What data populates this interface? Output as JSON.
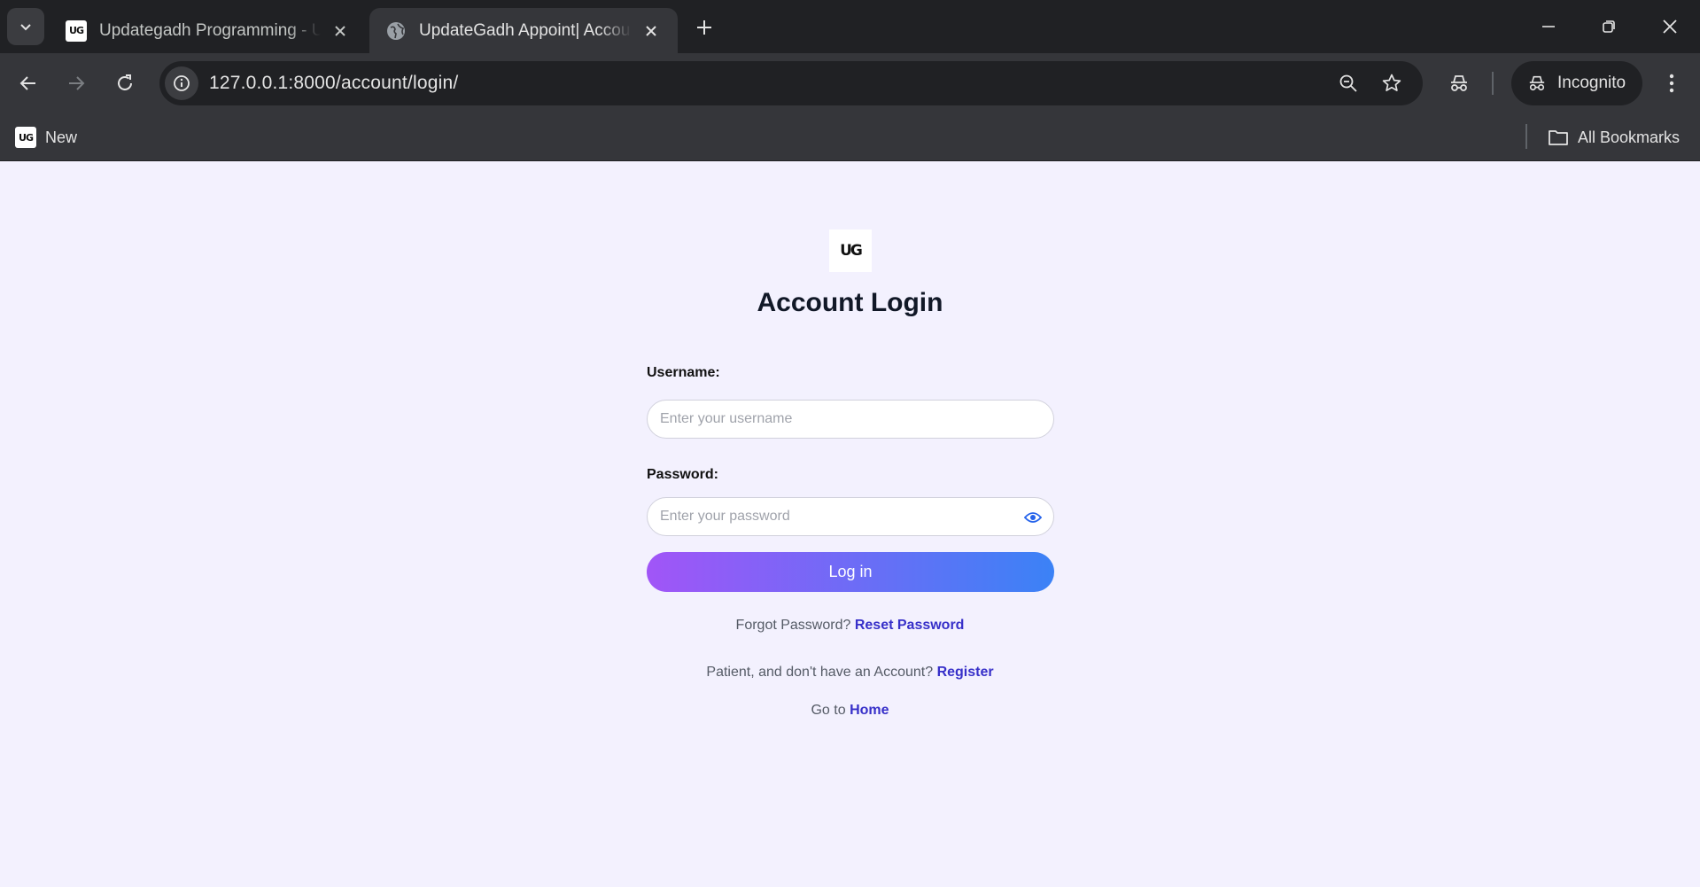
{
  "browser": {
    "tabs": [
      {
        "title": "Updategadh Programming - Up",
        "active": false,
        "favicon": "ug-logo"
      },
      {
        "title": "UpdateGadh Appoint| Account",
        "active": true,
        "favicon": "globe-icon"
      }
    ],
    "url": "127.0.0.1:8000/account/login/",
    "incognito_label": "Incognito",
    "bookmarks": {
      "items": [
        {
          "label": "New",
          "favicon": "ug-logo"
        }
      ],
      "all_bookmarks_label": "All Bookmarks"
    },
    "logo_text": "UG"
  },
  "page": {
    "logo_text": "UG",
    "title": "Account Login",
    "username_label": "Username:",
    "username_placeholder": "Enter your username",
    "password_label": "Password:",
    "password_placeholder": "Enter your password",
    "login_button": "Log in",
    "forgot_text": "Forgot Password?",
    "reset_link": "Reset Password",
    "register_text": "Patient, and don't have an Account?",
    "register_link": "Register",
    "home_text": "Go to",
    "home_link": "Home"
  },
  "colors": {
    "page_background": "#f3f1fe",
    "button_gradient_start": "#a155f7",
    "button_gradient_end": "#3b82f6",
    "link": "#3730c9"
  }
}
